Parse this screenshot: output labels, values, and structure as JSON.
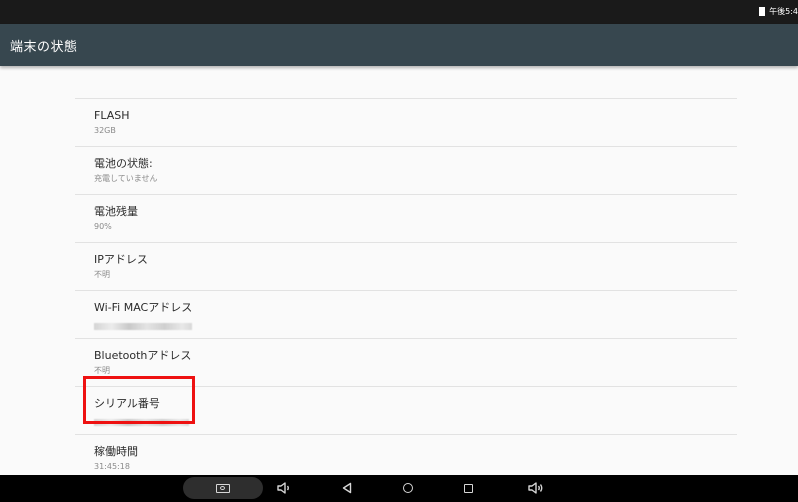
{
  "status_bar": {
    "clock": "午後5:4",
    "battery_icon": "battery-icon"
  },
  "app_bar": {
    "title": "端末の状態"
  },
  "list": {
    "items": [
      {
        "title": "",
        "value": ""
      },
      {
        "title": "FLASH",
        "value": "32GB"
      },
      {
        "title": "電池の状態:",
        "value": "充電していません"
      },
      {
        "title": "電池残量",
        "value": "90%"
      },
      {
        "title": "IPアドレス",
        "value": "不明"
      },
      {
        "title": "Wi-Fi MACアドレス",
        "value_redacted": true
      },
      {
        "title": "Bluetoothアドレス",
        "value": "不明"
      },
      {
        "title": "シリアル番号",
        "value_redacted": true
      },
      {
        "title": "稼働時間",
        "value": "31:45:18"
      }
    ]
  },
  "highlight": {
    "target": "シリアル番号",
    "color": "#ee1111"
  },
  "nav_bar": {
    "buttons": [
      "screenshot-icon",
      "volume-down-icon",
      "back-icon",
      "home-icon",
      "recent-apps-icon",
      "volume-up-icon"
    ]
  },
  "colors": {
    "app_bar": "#37474f",
    "status_bar": "#1a1a1a",
    "background": "#fafafa",
    "nav_bar": "#000000"
  }
}
